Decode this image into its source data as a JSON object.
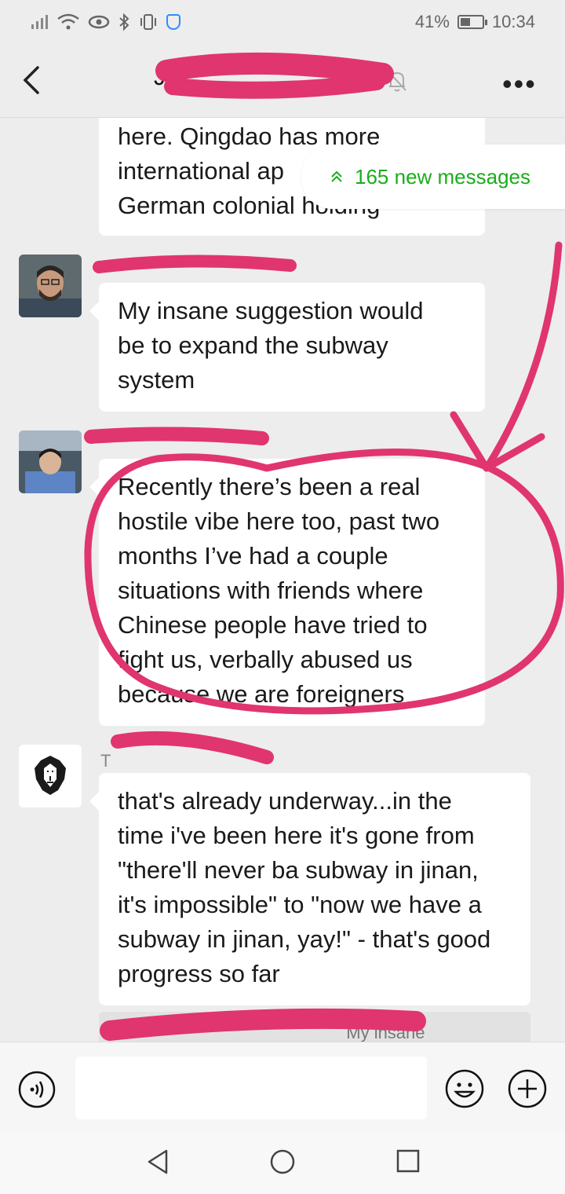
{
  "status_bar": {
    "battery": "41%",
    "time": "10:34",
    "left_icons": [
      "signal-icon",
      "wifi-icon",
      "eye-icon",
      "bluetooth-icon",
      "vibrate-icon",
      "shield-icon"
    ]
  },
  "header": {
    "title_visible": "J",
    "title_suffix": ")"
  },
  "new_messages_label": "165 new messages",
  "messages": [
    {
      "sender": "",
      "text": "here. Qingdao has more international ap German colonial holding",
      "lines": [
        "here. Qingdao has more",
        "international ap",
        "German colonial holding"
      ]
    },
    {
      "sender": "",
      "text": "My insane suggestion would be to expand the subway system",
      "lines": [
        "My insane suggestion would",
        "be to expand the subway",
        "system"
      ]
    },
    {
      "sender": "",
      "text": "Recently there’s been a real hostile vibe here too, past two months I’ve had a couple situations with friends where Chinese people have tried to fight us, verbally abused us because we are foreigners",
      "lines": [
        "Recently there’s been a real",
        "hostile vibe here too, past two",
        "months I’ve had a couple",
        "situations with friends where",
        "Chinese people have tried to",
        "fight us, verbally abused us",
        "because we are foreigners"
      ]
    },
    {
      "sender": "T",
      "text": "that's already underway...in the time i've been here it's gone from \"there'll never ba subway in jinan, it's impossible\" to \"now we have a subway in jinan, yay!\" - that's good progress so far",
      "lines": [
        "that's already underway...in the",
        "time i've been here it's gone from",
        "\"there'll never ba subway in jinan,",
        "it's impossible\" to \"now we have a",
        "subway in jinan, yay!\" - that's good",
        "progress so far"
      ]
    }
  ],
  "quote": {
    "prefix": "J",
    "text": "My insane"
  },
  "colors": {
    "accent_green": "#1aad19",
    "scribble": "#e0356f",
    "background": "#ededed"
  }
}
